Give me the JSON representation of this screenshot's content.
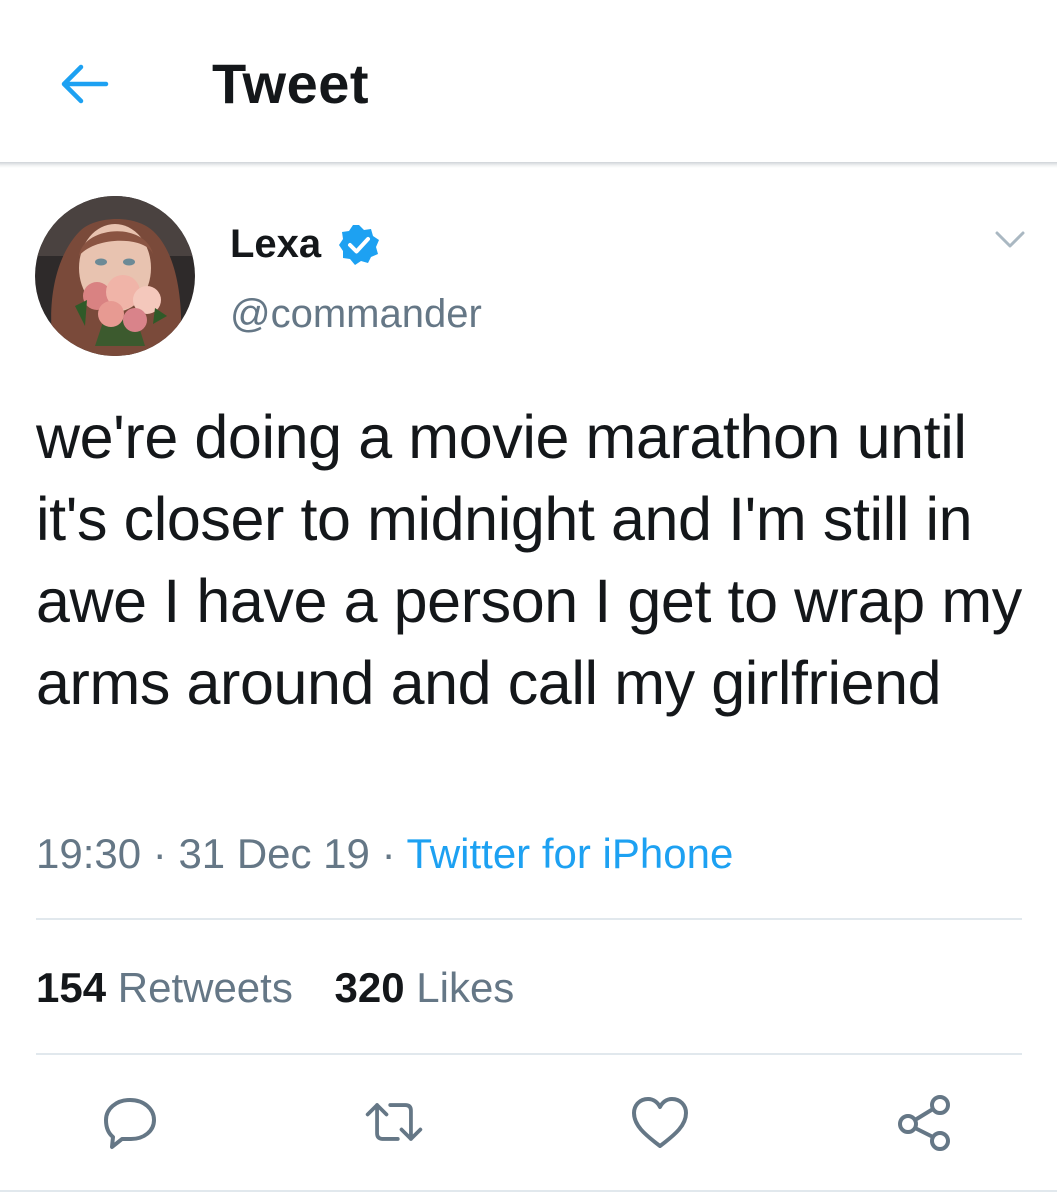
{
  "header": {
    "title": "Tweet",
    "back_icon": "arrow-left-icon"
  },
  "colors": {
    "accent": "#1da1f2",
    "text": "#14171a",
    "secondary": "#657786",
    "divider": "#e1e8ed"
  },
  "tweet": {
    "author": {
      "name": "Lexa",
      "handle": "@commander",
      "verified": true
    },
    "text": "we're doing a movie marathon until it's closer to midnight and I'm still in awe I have a person I get to wrap my arms around and call my girlfriend",
    "time": "19:30",
    "separator": " · ",
    "date": "31 Dec 19",
    "source": "Twitter for iPhone",
    "stats": {
      "retweets_count": "154",
      "retweets_label": "Retweets",
      "likes_count": "320",
      "likes_label": "Likes"
    }
  },
  "actions": [
    "reply-icon",
    "retweet-icon",
    "like-icon",
    "share-icon"
  ]
}
